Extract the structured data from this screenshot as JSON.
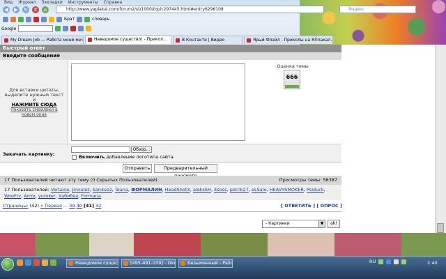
{
  "browser": {
    "menu": [
      "Вид",
      "Журнал",
      "Закладки",
      "Инструменты",
      "Справка"
    ],
    "url": "http://www.yaplakal.com/forum2/st/1000/topic297445.html#entry6296108",
    "search_placeholder": "Яндекс",
    "toolbar_words": [
      "Брат",
      "словарь"
    ],
    "google_label": "Google",
    "tabs": [
      {
        "label": "My Dream Job — Работа моей меч...",
        "active": false
      },
      {
        "label": "Неведомое существо! - Прикол...",
        "active": true
      },
      {
        "label": "В Контакте | Видео",
        "active": false
      },
      {
        "label": "Ярый Флэйл - Приколы на ЯПлакал...",
        "active": false
      }
    ]
  },
  "quick_reply": {
    "title": "Быстрый ответ",
    "enter_message": "Введите сообщение",
    "hint_text": "Для вставки цитаты, выделите нужный текст и",
    "hint_action": "НАЖМИТЕ СЮДА",
    "smilies_link": "Показать смайлики в новом окне",
    "rating_label": "Оценка темы",
    "rating_value": "666",
    "upload_label": "Закачать картинку:",
    "browse_label": "Обзор...",
    "logo_prefix": "Включить",
    "logo_suffix": "добавление логотипа сайта",
    "send_label": "Отправить",
    "preview_label": "Предварительный просмотр"
  },
  "stats": {
    "reading": "17 Пользователей читают эту тему (0 Скрытых Пользователей)",
    "views": "Просмотры темы: 56387",
    "users_prefix": "17 Пользователей:",
    "users": [
      "Verlaine",
      "Jinnulez",
      "San4ez2",
      "Teana",
      "ФОРМАЛИН",
      "HeadShotX",
      "aleksSH",
      "itsoss",
      "petrik27",
      "eLSalo",
      "HEAVYSMOKER",
      "Psiduck",
      "WooFtv",
      "Amix",
      "yuroker",
      "Хабибка",
      "Formana"
    ]
  },
  "pagination": {
    "label": "Страницы:",
    "count": "(42)",
    "first": "« Первая",
    "ellipsis": "...",
    "pages": [
      "39",
      "40",
      "[41]",
      "42"
    ]
  },
  "actions": {
    "reply": "[ ОТВЕТИТЬ ]",
    "poll": "[ ОПРОС ]"
  },
  "jump": {
    "selected": "- Картинки",
    "go_label": "ok!"
  },
  "taskbar": {
    "tasks": [
      "Неведомое сущест...",
      "[495-491-109] - Окн...",
      "Безымянный - Paint"
    ],
    "lang": "RU",
    "time": "2:40"
  }
}
